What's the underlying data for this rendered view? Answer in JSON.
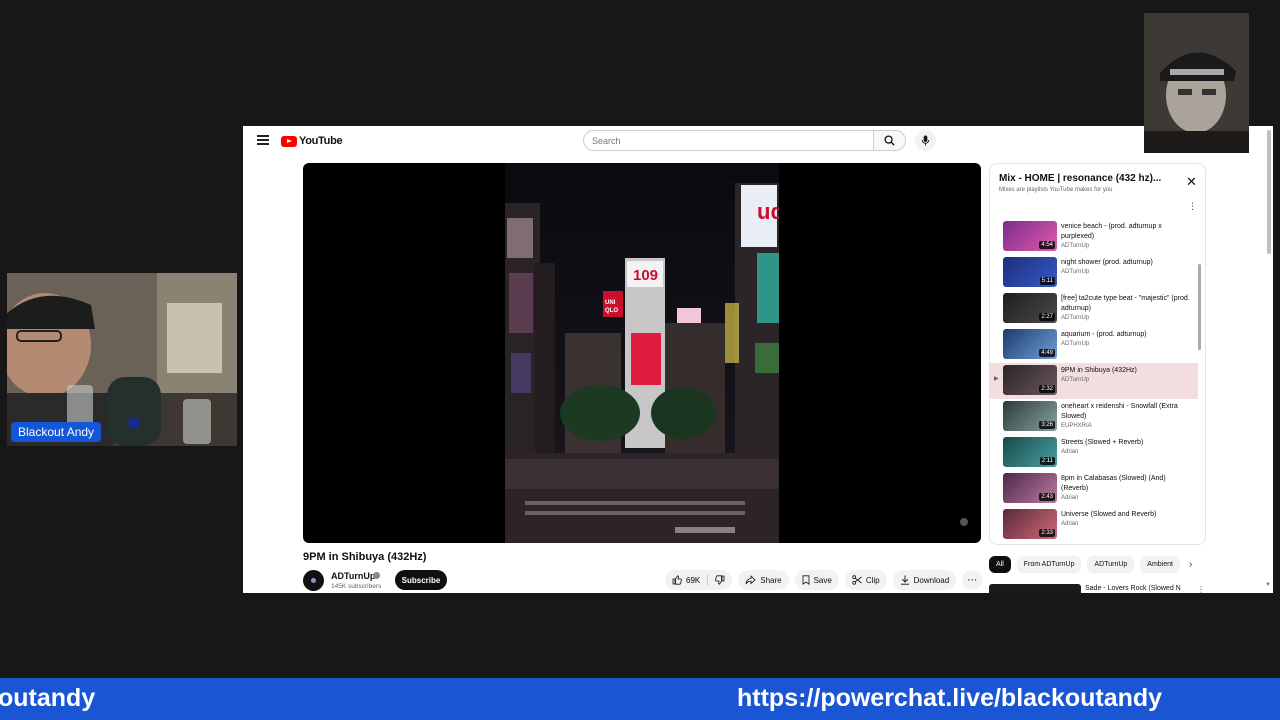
{
  "youtube": {
    "logo_text": "YouTube",
    "search_placeholder": "Search",
    "video": {
      "title": "9PM in Shibuya (432Hz)",
      "channel": "ADTurnUp",
      "subscribers": "145K subscribers",
      "subscribe_label": "Subscribe",
      "likes": "69K",
      "share_label": "Share",
      "save_label": "Save",
      "clip_label": "Clip",
      "download_label": "Download"
    },
    "playlist": {
      "title": "Mix - HOME | resonance (432 hz)...",
      "subtitle": "Mixes are playlists YouTube makes for you",
      "items": [
        {
          "title": "venice beach - (prod. adturnup x purplexed)",
          "channel": "ADTurnUp",
          "duration": "4:54",
          "active": false
        },
        {
          "title": "night shower (prod. adturnup)",
          "channel": "ADTurnUp",
          "duration": "5:11",
          "active": false
        },
        {
          "title": "[free] ta2cute type beat - \"majestic\" (prod. adturnup)",
          "channel": "ADTurnUp",
          "duration": "2:27",
          "active": false
        },
        {
          "title": "aquarium - (prod. adturnup)",
          "channel": "ADTurnUp",
          "duration": "4:49",
          "active": false
        },
        {
          "title": "9PM in Shibuya (432Hz)",
          "channel": "ADTurnUp",
          "duration": "2:32",
          "active": true
        },
        {
          "title": "oneheart x reidenshi - Snowfall (Extra Slowed)",
          "channel": "EUPHXRIA",
          "duration": "3:26",
          "active": false
        },
        {
          "title": "Streets (Slowed + Reverb)",
          "channel": "Adrian",
          "duration": "2:11",
          "active": false
        },
        {
          "title": "8pm in Calabasas (Slowed) (And) (Reverb)",
          "channel": "Adrian",
          "duration": "2:43",
          "active": false
        },
        {
          "title": "Universe (Slowed and Reverb)",
          "channel": "Adrian",
          "duration": "2:33",
          "active": false
        }
      ]
    },
    "chips": [
      "All",
      "From ADTurnUp",
      "ADTurnUp",
      "Ambient"
    ],
    "recommendation": {
      "title": "Sade - Lovers Rock (Slowed N"
    }
  },
  "stream": {
    "name_tag": "Blackout Andy",
    "ticker_left": "outandy",
    "ticker_right": "https://powerchat.live/blackoutandy"
  },
  "colors": {
    "ticker_blue": "#1a56d4",
    "name_tag_blue": "#1456d6",
    "youtube_red": "#ff0000",
    "active_row": "#f2dede"
  }
}
